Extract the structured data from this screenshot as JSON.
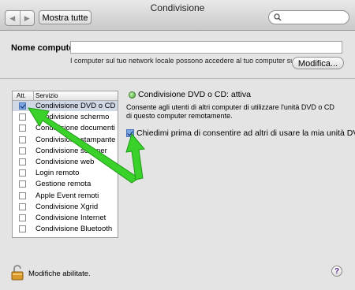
{
  "window": {
    "title": "Condivisione"
  },
  "toolbar": {
    "show_all_label": "Mostra tutte",
    "search_placeholder": ""
  },
  "computer_name": {
    "label": "Nome computer:",
    "value": "",
    "info": "I computer sul tuo network locale possono accedere al tuo computer su:",
    "modify_label": "Modifica..."
  },
  "services": {
    "header_on": "Att.",
    "header_service": "Servizio",
    "items": [
      {
        "label": "Condivisione DVD o CD",
        "checked": true,
        "selected": true
      },
      {
        "label": "Condivisione schermo",
        "checked": false
      },
      {
        "label": "Condivisione documenti",
        "checked": false
      },
      {
        "label": "Condivisione stampante",
        "checked": false
      },
      {
        "label": "Condivisione scanner",
        "checked": false
      },
      {
        "label": "Condivisione web",
        "checked": false
      },
      {
        "label": "Login remoto",
        "checked": false
      },
      {
        "label": "Gestione remota",
        "checked": false
      },
      {
        "label": "Apple Event remoti",
        "checked": false
      },
      {
        "label": "Condivisione Xgrid",
        "checked": false
      },
      {
        "label": "Condivisione Internet",
        "checked": false
      },
      {
        "label": "Condivisione Bluetooth",
        "checked": false
      }
    ]
  },
  "detail": {
    "status": "Condivisione DVD o CD: attiva",
    "status_color": "#3fa12b",
    "description": "Consente agli utenti di altri computer di utilizzare l'unità DVD o CD di questo computer remotamente.",
    "ask_label": "Chiedimi prima di consentire ad altri di usare la mia unità DVD",
    "ask_checked": true
  },
  "footer": {
    "lock_label": "Modifiche abilitate.",
    "help_label": "?"
  },
  "annotation_color": "#3ad12a"
}
